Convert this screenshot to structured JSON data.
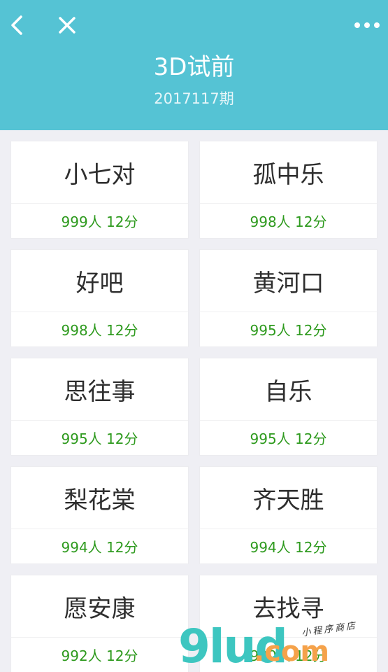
{
  "header": {
    "title": "3D试前",
    "issue": "2017117期",
    "bg_color": "#55c3d4",
    "icons": {
      "back": "chevron-left-icon",
      "close": "close-icon",
      "more": "more-dots-icon"
    }
  },
  "cards": [
    {
      "name": "小七对",
      "meta": "999人 12分"
    },
    {
      "name": "孤中乐",
      "meta": "998人 12分"
    },
    {
      "name": "好吧",
      "meta": "998人 12分"
    },
    {
      "name": "黄河口",
      "meta": "995人 12分"
    },
    {
      "name": "思往事",
      "meta": "995人 12分"
    },
    {
      "name": "自乐",
      "meta": "995人 12分"
    },
    {
      "name": "梨花棠",
      "meta": "994人 12分"
    },
    {
      "name": "齐天胜",
      "meta": "994人 12分"
    },
    {
      "name": "愿安康",
      "meta": "992人 12分"
    },
    {
      "name": "去找寻",
      "meta": "990人 12分"
    }
  ],
  "watermark": {
    "brand": "9lud",
    "suffix": ".com",
    "tagline": "小程序商店"
  },
  "colors": {
    "meta_green": "#2e9a1e",
    "page_bg": "#efeff4"
  }
}
